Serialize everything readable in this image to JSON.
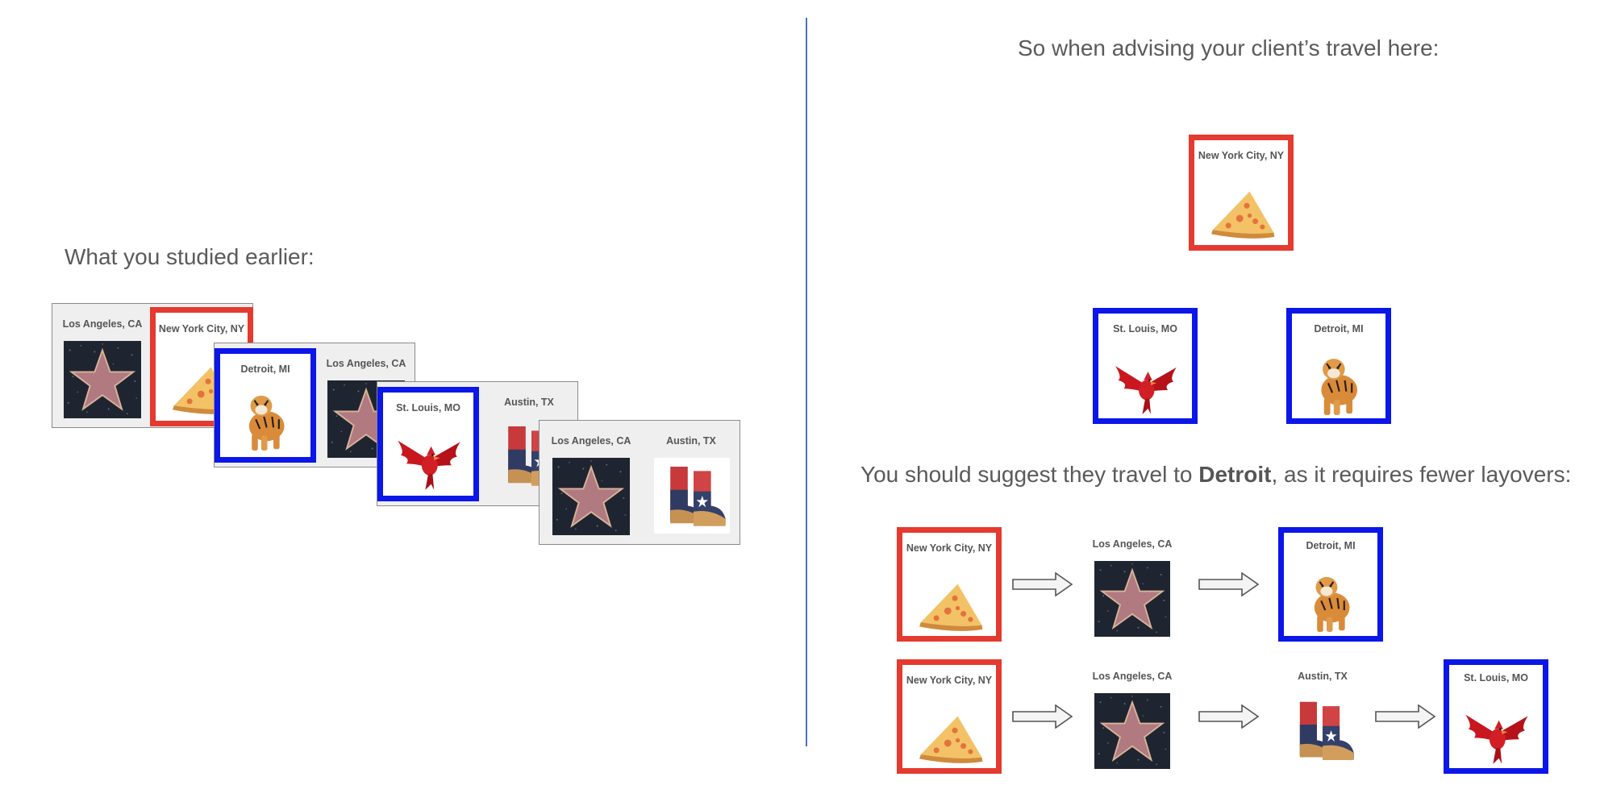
{
  "left_heading": "What you studied earlier:",
  "right_heading": "So when advising your client’s travel here:",
  "suggestion": {
    "before": "You should suggest they travel to ",
    "bold": "Detroit",
    "after": ", as it requires fewer layovers:"
  },
  "cities": {
    "la": "Los Angeles, CA",
    "nyc": "New York City, NY",
    "detroit": "Detroit, MI",
    "stl": "St. Louis, MO",
    "austin": "Austin, TX"
  },
  "icons": {
    "la": "hollywood-star-icon",
    "nyc": "pizza-slice-icon",
    "detroit": "tiger-icon",
    "stl": "cardinal-bird-icon",
    "austin": "cowboy-boots-icon"
  },
  "colors": {
    "start_frame": "#e53a2f",
    "option_frame": "#0b16e8",
    "divider": "#4a72c4"
  }
}
